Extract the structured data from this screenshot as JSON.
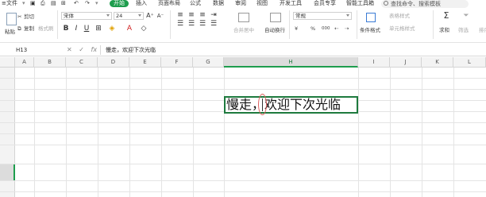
{
  "menubar": {
    "file": "文件",
    "tabs": [
      "开始",
      "插入",
      "页面布局",
      "公式",
      "数据",
      "审阅",
      "视图",
      "开发工具",
      "会员专享",
      "智能工具箱"
    ],
    "active_tab": "开始",
    "search_placeholder": "查找命令、搜索模板"
  },
  "ribbon": {
    "cut": "剪切",
    "paste": "粘贴",
    "copy": "复制",
    "format_painter": "格式刷",
    "font_name": "宋体",
    "font_size": "24",
    "bold": "B",
    "italic": "I",
    "underline": "U",
    "merge_center": "合并居中",
    "wrap_text": "自动换行",
    "number_format": "常规",
    "currency": "¥",
    "percent": "%",
    "thousands": "000",
    "conditional_format": "条件格式",
    "table_style": "表格样式",
    "cell_style": "单元格样式",
    "sum": "求和",
    "filter": "筛选",
    "sort": "排序"
  },
  "formula_bar": {
    "cell_ref": "H13",
    "content": "慢走，欢迎下次光临"
  },
  "columns": [
    "A",
    "B",
    "C",
    "D",
    "E",
    "F",
    "G",
    "H",
    "I",
    "J",
    "K",
    "L"
  ],
  "selected_column": "H",
  "active_cell": {
    "ref": "H13",
    "value": "慢走，欢迎下次光临"
  },
  "colors": {
    "accent": "#1e9d4d",
    "selection_border": "#1e7a3e"
  }
}
